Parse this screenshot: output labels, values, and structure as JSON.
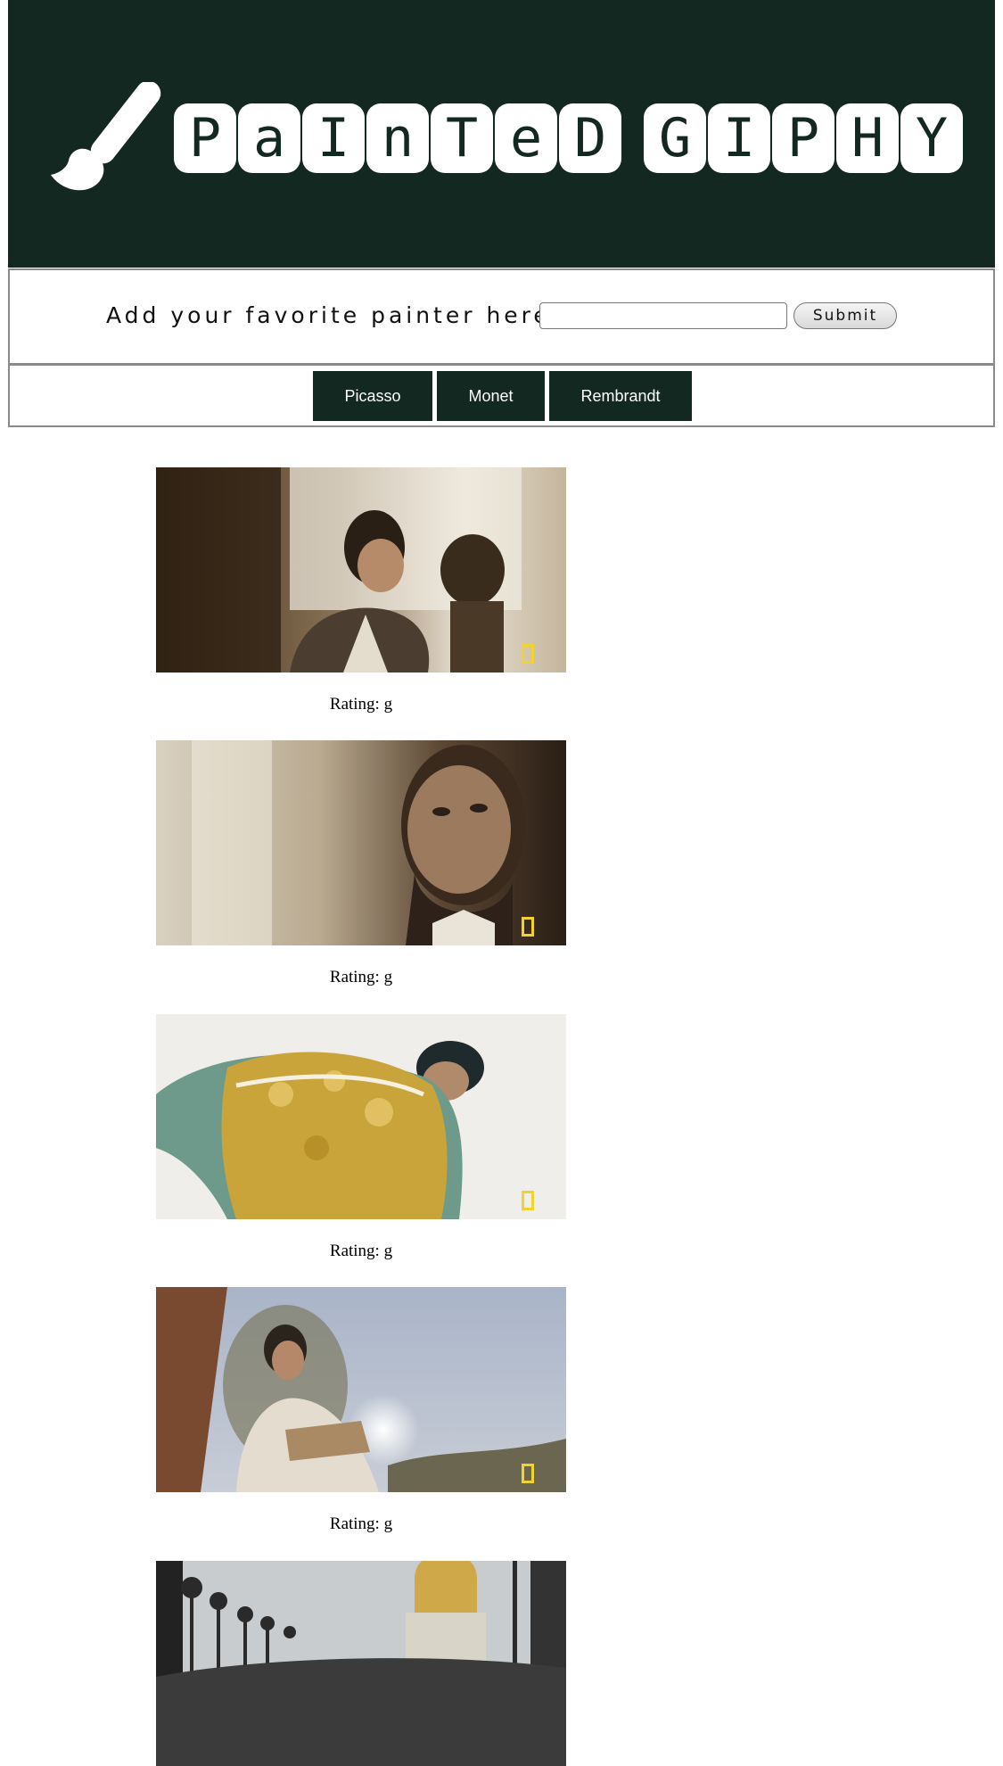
{
  "header": {
    "title": "painted giphy",
    "title_tiles": [
      "P",
      "a",
      "I",
      "n",
      "T",
      "e",
      "D",
      "G",
      "I",
      "P",
      "H",
      "Y"
    ],
    "logo_icon": "paintbrush-icon",
    "background_color": "#142822"
  },
  "form": {
    "label": "Add your favorite painter here:",
    "input_value": "",
    "submit_label": "Submit"
  },
  "tabs": [
    {
      "label": "Picasso"
    },
    {
      "label": "Monet"
    },
    {
      "label": "Rembrandt"
    }
  ],
  "gifs": [
    {
      "description": "boy in vest sitting by a window next to a bust",
      "rating": "Rating: g"
    },
    {
      "description": "close-up of bearded man looking sideways",
      "rating": "Rating: g"
    },
    {
      "description": "matador in gold embroidered jacket bending forward",
      "rating": "Rating: g"
    },
    {
      "description": "painter holding a palette outdoors against a bright sky",
      "rating": "Rating: g"
    },
    {
      "description": "crowd on an ornate bridge with a golden dome in the background",
      "rating": ""
    }
  ],
  "accent_badge_color": "#f2d32b"
}
